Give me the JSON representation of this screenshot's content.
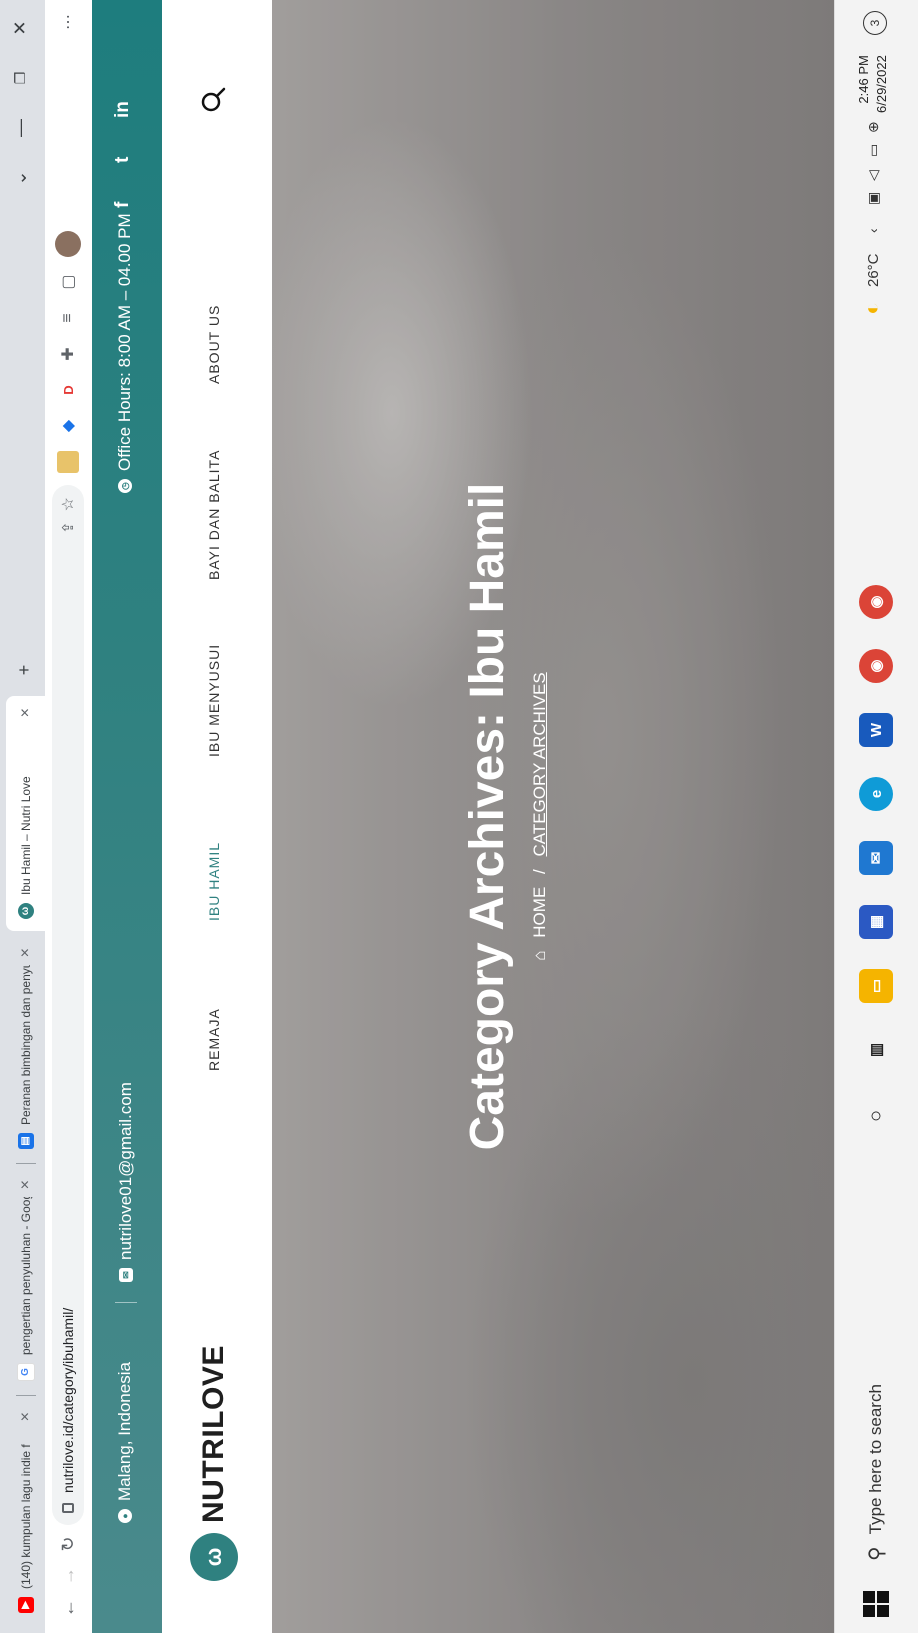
{
  "browser": {
    "tabs": [
      {
        "title": "(140) kumpulan lagu indie f",
        "icon": "youtube-icon",
        "color": "#ff0000"
      },
      {
        "title": "pengertian penyuluhan - Google",
        "icon": "google-icon",
        "color": "#4285f4"
      },
      {
        "title": "Peranan bimbingan dan penyulu",
        "icon": "document-icon",
        "color": "#1a73e8"
      },
      {
        "title": "Ibu Hamil – Nutri Love",
        "icon": "nutrilove-icon",
        "color": "#2f8180"
      }
    ],
    "new_tab": "+",
    "url": "nutrilove.id/category/ibuhamil/"
  },
  "site": {
    "topbar": {
      "location": "Malang, Indonesia",
      "email": "nutrilove01@gmail.com",
      "hours": "Office Hours: 8:00 AM – 04.00 PM",
      "social": [
        "f",
        "t",
        "in"
      ]
    },
    "logo": {
      "text": "NUTRILOVE"
    },
    "menu": [
      "REMAJA",
      "IBU HAMIL",
      "IBU MENYUSUI",
      "BAYI DAN BALITA",
      "ABOUT US"
    ],
    "hero": {
      "title": "Category Archives: Ibu Hamil",
      "crumb_home": "HOME",
      "crumb_sep": "/",
      "crumb_current": "CATEGORY ARCHIVES"
    }
  },
  "taskbar": {
    "search_placeholder": "Type here to search",
    "weather": "26°C",
    "time": "2:46 PM",
    "date": "6/29/2022",
    "notifications": "3"
  },
  "colors": {
    "teal": "#2f8180",
    "active_menu": "#2f8180"
  }
}
